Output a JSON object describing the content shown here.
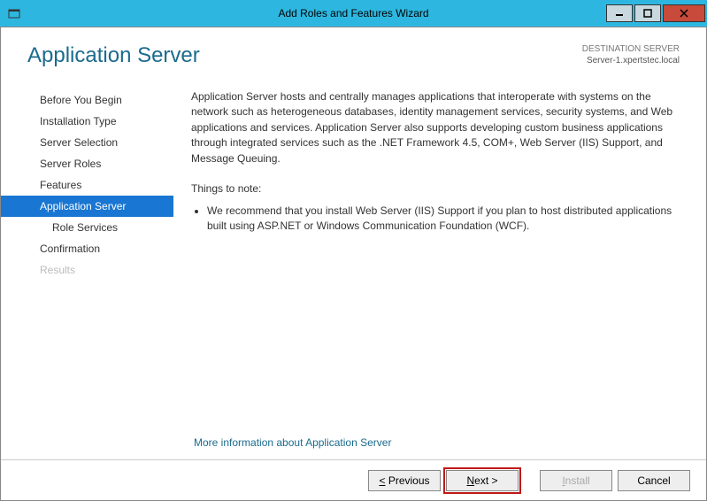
{
  "titlebar": {
    "title": "Add Roles and Features Wizard"
  },
  "header": {
    "page_title": "Application Server",
    "dest_label": "DESTINATION SERVER",
    "dest_value": "Server-1.xpertstec.local"
  },
  "sidebar": {
    "items": [
      {
        "label": "Before You Begin",
        "selected": false,
        "sub": false,
        "disabled": false
      },
      {
        "label": "Installation Type",
        "selected": false,
        "sub": false,
        "disabled": false
      },
      {
        "label": "Server Selection",
        "selected": false,
        "sub": false,
        "disabled": false
      },
      {
        "label": "Server Roles",
        "selected": false,
        "sub": false,
        "disabled": false
      },
      {
        "label": "Features",
        "selected": false,
        "sub": false,
        "disabled": false
      },
      {
        "label": "Application Server",
        "selected": true,
        "sub": false,
        "disabled": false
      },
      {
        "label": "Role Services",
        "selected": false,
        "sub": true,
        "disabled": false
      },
      {
        "label": "Confirmation",
        "selected": false,
        "sub": false,
        "disabled": false
      },
      {
        "label": "Results",
        "selected": false,
        "sub": false,
        "disabled": true
      }
    ]
  },
  "main": {
    "description": "Application Server hosts and centrally manages applications that interoperate with systems on the network such as heterogeneous databases, identity management services, security systems, and Web applications and services. Application Server also supports developing custom business applications through integrated services such as the .NET Framework 4.5, COM+, Web Server (IIS) Support, and Message Queuing.",
    "note_heading": "Things to note:",
    "notes": [
      "We recommend that you install Web Server (IIS) Support if you plan to host distributed applications built using ASP.NET or Windows Communication Foundation (WCF)."
    ],
    "more_info": "More information about Application Server"
  },
  "buttons": {
    "previous": "Previous",
    "next": "Next >",
    "install": "Install",
    "cancel": "Cancel"
  }
}
